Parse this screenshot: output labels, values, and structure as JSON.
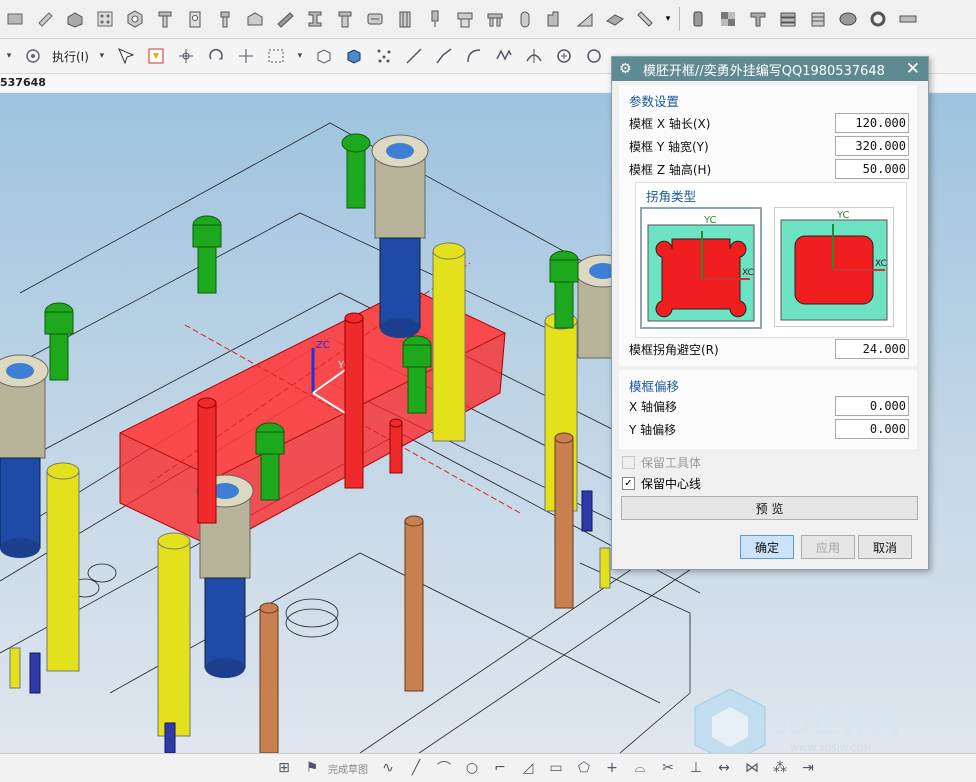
{
  "toolbar": {
    "execute_label": "执行(I)"
  },
  "part_id": "537648",
  "statusbar": {
    "finish_sketch_label": "完成草图"
  },
  "dialog": {
    "title": "模胚开框//奕勇外挂编写QQ1980537648",
    "params_section": "参数设置",
    "fields": [
      {
        "label": "模框 X 轴长(X)",
        "value": "120.000"
      },
      {
        "label": "模框 Y 轴宽(Y)",
        "value": "320.000"
      },
      {
        "label": "模框 Z 轴高(H)",
        "value": "50.000"
      }
    ],
    "corner_type_label": "拐角类型",
    "corner_axes": {
      "y": "YC",
      "x": "XC"
    },
    "corner_relief": {
      "label": "模框拐角避空(R)",
      "value": "24.000"
    },
    "offset_section": "模框偏移",
    "offsets": [
      {
        "label": "X 轴偏移",
        "value": "0.000"
      },
      {
        "label": "Y 轴偏移",
        "value": "0.000"
      }
    ],
    "keep_tool_body": {
      "label": "保留工具体",
      "checked": false,
      "enabled": false
    },
    "keep_centerline": {
      "label": "保留中心线",
      "checked": true,
      "enabled": true
    },
    "preview_label": "预 览",
    "ok_label": "确定",
    "apply_label": "应用",
    "cancel_label": "取消"
  },
  "viewport": {
    "triad": {
      "z": "ZC",
      "y": "YC"
    }
  },
  "watermark": {
    "brand": "3D世界网",
    "url": "WWW.3DSJW.COM"
  },
  "colors": {
    "title_bar": "#5e8a91",
    "section_title": "#1a5a9b",
    "pocket_red": "#ff2020",
    "bolt_green": "#1ea81e",
    "bushing_tan": "#b8b49a",
    "pin_yellow": "#e3e01c",
    "pin_blue": "#1f4aa8",
    "pin_copper": "#c98050"
  }
}
